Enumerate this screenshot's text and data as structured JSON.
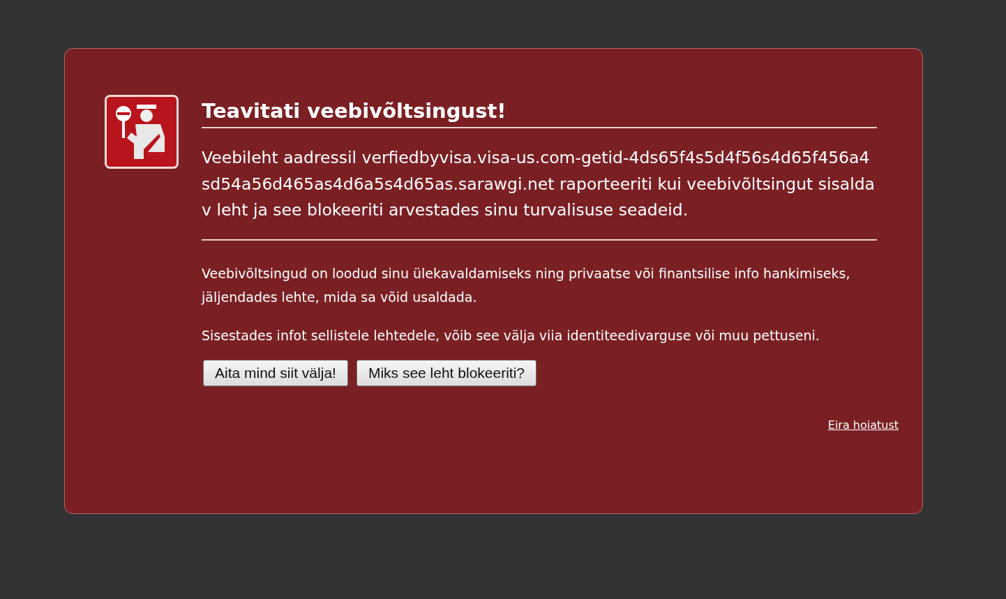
{
  "title": "Teavitati veebivõltsingust!",
  "message": "Veebileht aadressil verfiedbyvisa.visa-us.com-getid-4ds65f4s5d4f56s4d65f456a4sd54a56d465as4d6a5s4d65as.sarawgi.net raporteeriti kui veebivõltsingut sisaldav leht ja see blokeeriti arvestades sinu turvalisuse seadeid.",
  "details": [
    "Veebivõltsingud on loodud sinu ülekavaldamiseks ning privaatse või finantsilise info hankimiseks, jäljendades lehte, mida sa võid usaldada.",
    "Sisestades infot sellistele lehtedele, võib see välja viia identiteedivarguse või muu pettuseni."
  ],
  "buttons": [
    "Aita mind siit välja!",
    "Miks see leht blokeeriti?"
  ],
  "ignore_link": "Eira hoiatust"
}
